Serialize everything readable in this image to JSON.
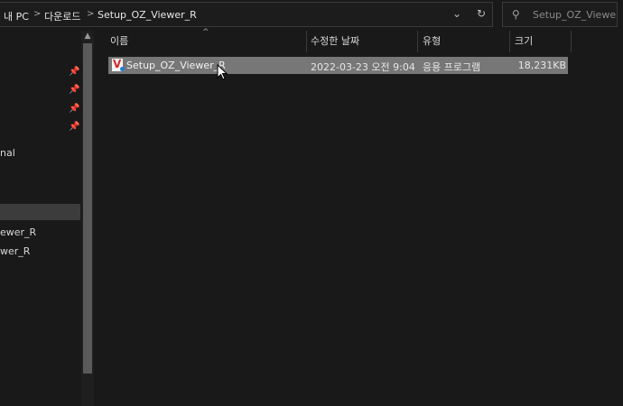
{
  "address": {
    "crumbs": [
      "내 PC",
      "다운로드",
      "Setup_OZ_Viewer_R"
    ],
    "separator": ">",
    "dropdown_icon": "chevron-down-icon",
    "refresh_icon": "refresh-icon"
  },
  "search": {
    "placeholder": "Setup_OZ_Viewer_..."
  },
  "nav": {
    "items": [
      "nal",
      "ewer_R",
      "wer_R"
    ]
  },
  "columns": {
    "name": "이름",
    "date": "수정한 날짜",
    "type": "유형",
    "size": "크기"
  },
  "files": [
    {
      "name": "Setup_OZ_Viewer_R",
      "date": "2022-03-23 오전 9:04",
      "type": "응용 프로그램",
      "size": "18,231KB"
    }
  ]
}
